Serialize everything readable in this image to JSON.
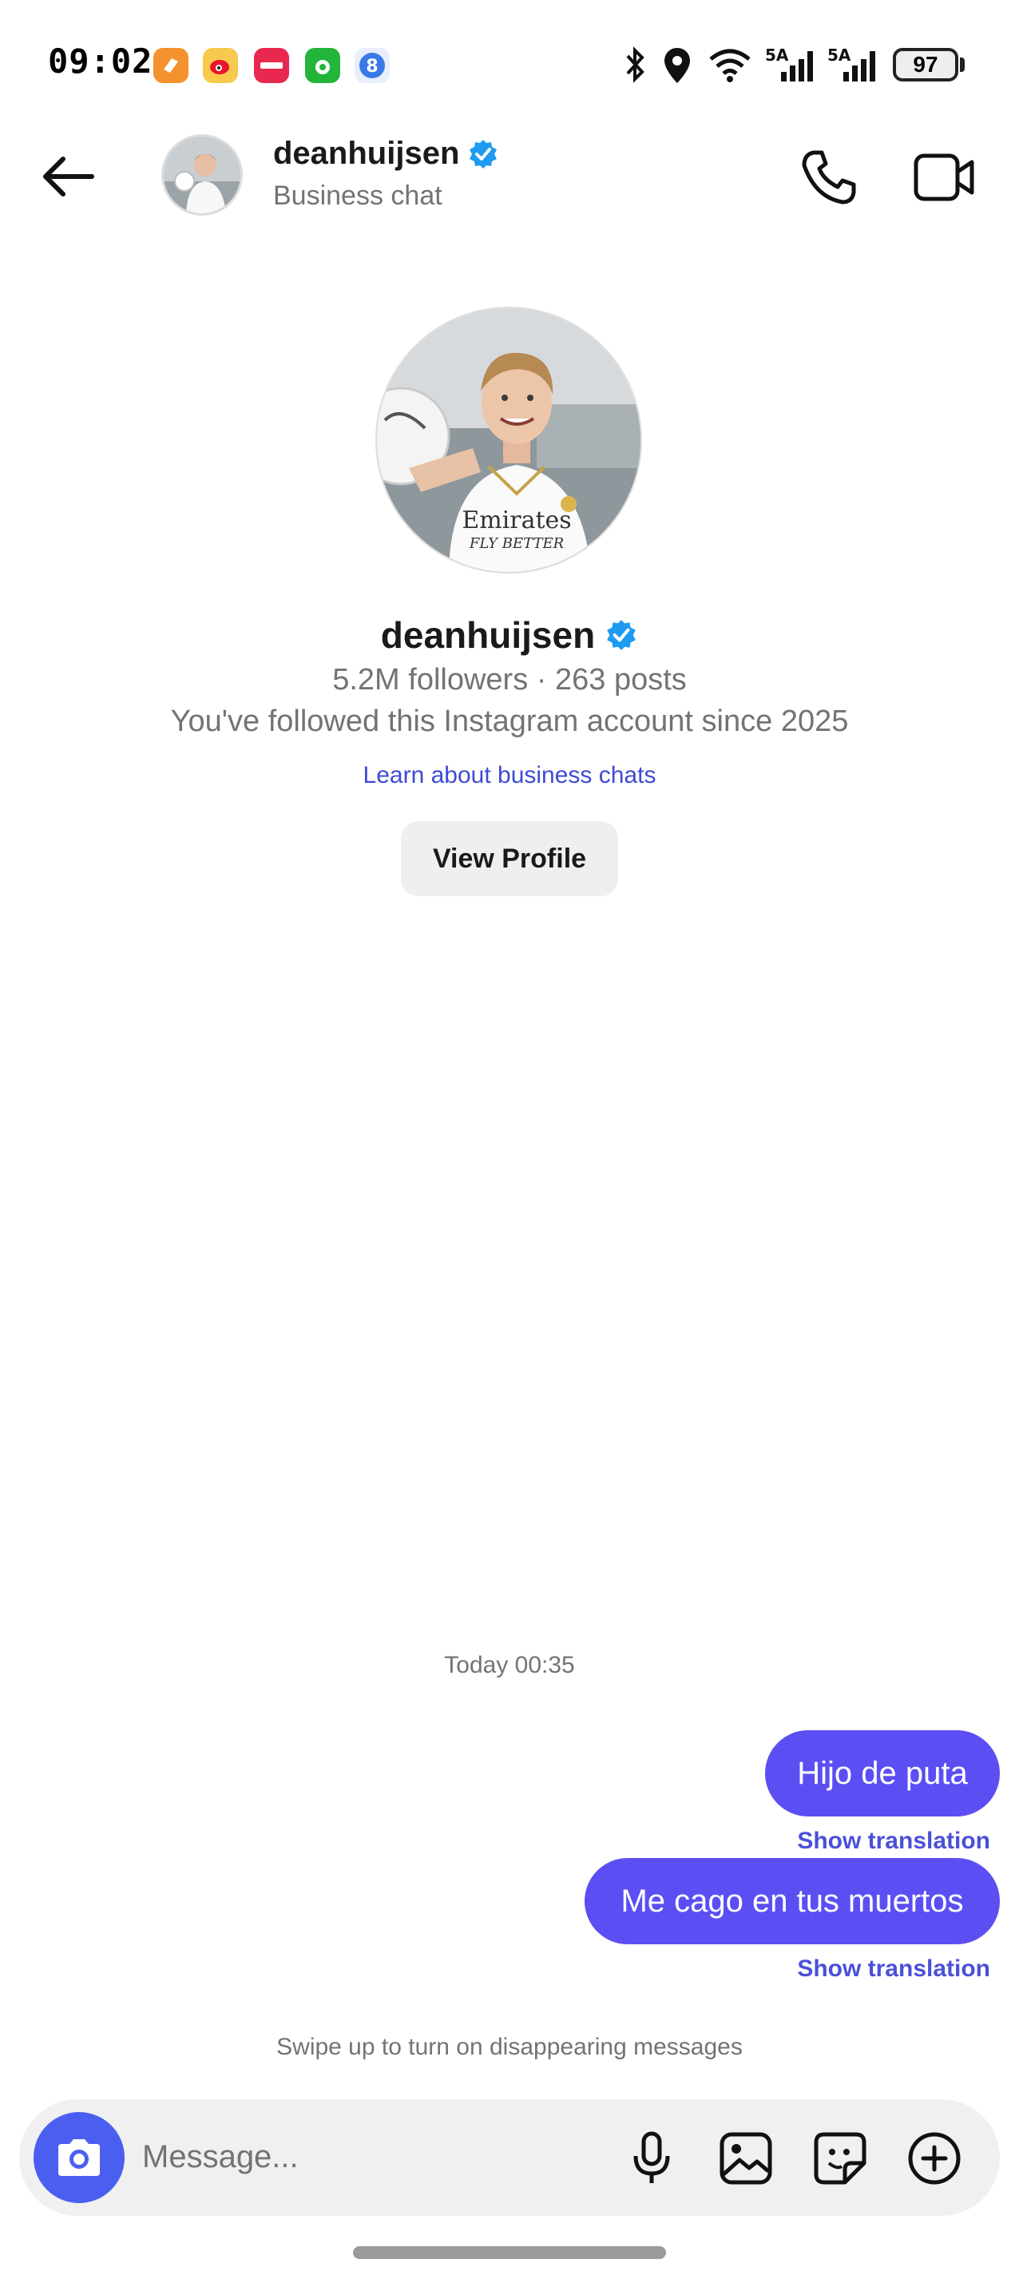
{
  "status_bar": {
    "time": "09:02",
    "battery": "97",
    "network_1": "5A",
    "network_2": "5A",
    "app_icons": [
      "orange-app-icon",
      "weibo-icon",
      "red-app-icon",
      "green-app-icon",
      "blue-8-app-icon"
    ],
    "icons": [
      "bluetooth-icon",
      "location-icon",
      "wifi-icon",
      "signal-icon",
      "battery-icon"
    ]
  },
  "header": {
    "username": "deanhuijsen",
    "subtitle": "Business chat",
    "verified": true
  },
  "profile": {
    "username": "deanhuijsen",
    "stats": "5.2M followers · 263 posts",
    "since": "You've followed this Instagram account since 2025",
    "learn_link": "Learn about business chats",
    "view_profile_label": "View Profile",
    "shirt_text_1": "Emirates",
    "shirt_text_2": "FLY BETTER"
  },
  "conversation": {
    "timestamp": "Today 00:35",
    "messages": [
      {
        "text": "Hijo de puta",
        "translation_label": "Show translation"
      },
      {
        "text": "Me cago en tus muertos",
        "translation_label": "Show translation"
      }
    ],
    "swipe_hint": "Swipe up to turn on disappearing messages"
  },
  "composer": {
    "placeholder": "Message..."
  },
  "colors": {
    "accent_bubble": "#5b4ff3",
    "camera_button": "#4a5ff0",
    "link": "#3d4bd4",
    "verified_badge": "#1d9bf0"
  }
}
